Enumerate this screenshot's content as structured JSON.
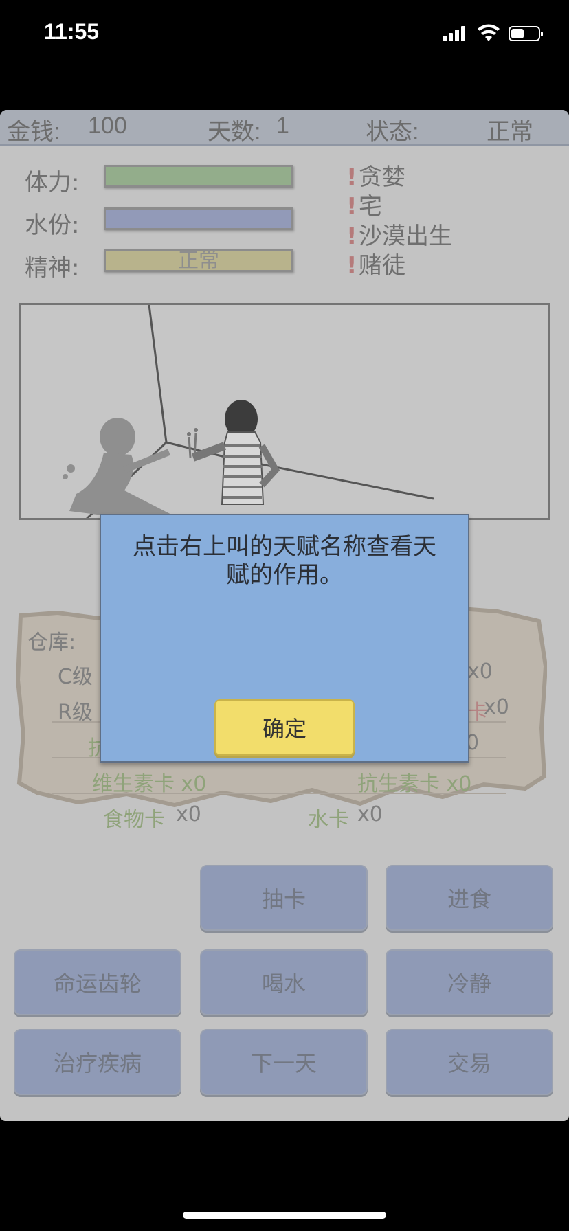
{
  "status_bar": {
    "time": "11:55"
  },
  "top_bar": {
    "money_label": "金钱:",
    "money_value": "100",
    "days_label": "天数:",
    "days_value": "1",
    "state_label": "状态:",
    "state_value": "正常"
  },
  "stats": [
    {
      "label": "体力:",
      "color": "#93ad8b",
      "text": ""
    },
    {
      "label": "水份:",
      "color": "#929ab8",
      "text": ""
    },
    {
      "label": "精神:",
      "color": "#b8b38c",
      "text": "正常"
    }
  ],
  "talents": [
    "贪婪",
    "宅",
    "沙漠出生",
    "赌徒"
  ],
  "inventory": {
    "title": "仓库:",
    "c_level": "C级",
    "r_level": "R级",
    "row1_right": "x0",
    "row2_right_red": "卡",
    "row2_right": "x0",
    "row3_left": "抗",
    "row3_right": "0",
    "row4_left": "维生素卡 x0",
    "row4_right": "抗生素卡 x0",
    "food_card": "食物卡",
    "food_count": "x0",
    "water_card": "水卡",
    "water_count": "x0"
  },
  "actions": {
    "draw": "抽卡",
    "eat": "进食",
    "fate": "命运齿轮",
    "drink": "喝水",
    "calm": "冷静",
    "heal": "治疗疾病",
    "next_day": "下一天",
    "trade": "交易"
  },
  "dialog": {
    "message_line1": "点击右上叫的天赋名称查看天",
    "message_line2": "赋的作用。",
    "confirm": "确定"
  },
  "colors": {
    "dialog_bg": "#88aedc",
    "confirm_btn": "#f2dd6b",
    "action_btn": "#8f9ab6"
  }
}
